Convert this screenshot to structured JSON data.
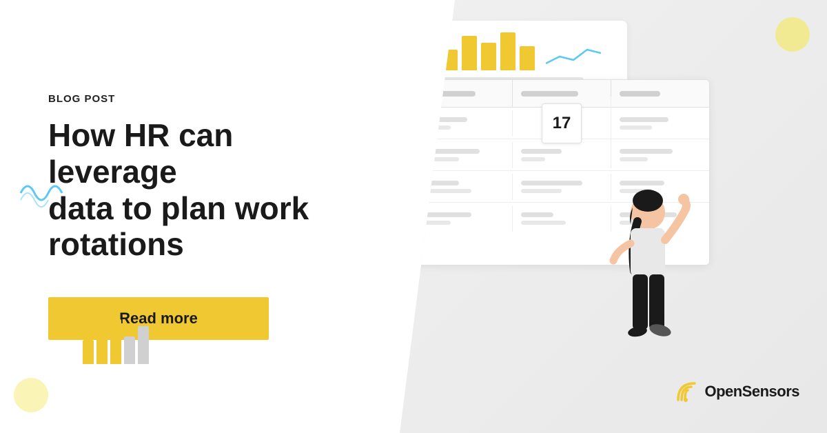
{
  "page": {
    "background_color": "#ffffff",
    "accent_color": "#f0c832",
    "text_color": "#1a1a1a"
  },
  "left": {
    "blog_label": "BLOG POST",
    "title_line1": "How HR can leverage",
    "title_line2": "data to plan work",
    "title_line3": "rotations",
    "read_more_label": "Read more"
  },
  "right": {
    "calendar_number": "17",
    "logo_name": "OpenSensors"
  },
  "decorations": {
    "mini_bars": [
      {
        "height": 35,
        "color": "#f0c832"
      },
      {
        "height": 50,
        "color": "#f0c832"
      },
      {
        "height": 65,
        "color": "#f0c832"
      },
      {
        "height": 40,
        "color": "#d0d0d0"
      },
      {
        "height": 55,
        "color": "#d0d0d0"
      }
    ]
  }
}
